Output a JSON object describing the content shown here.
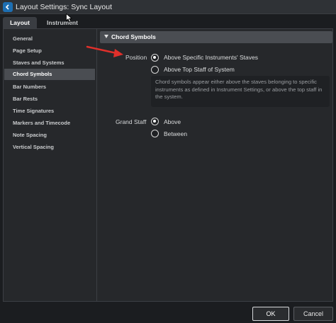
{
  "window": {
    "title": "Layout Settings: Sync Layout"
  },
  "tabs": [
    {
      "label": "Layout",
      "active": true
    },
    {
      "label": "Instrument",
      "active": false
    }
  ],
  "sidebar": {
    "items": [
      {
        "label": "General"
      },
      {
        "label": "Page Setup"
      },
      {
        "label": "Staves and Systems"
      },
      {
        "label": "Chord Symbols",
        "selected": true
      },
      {
        "label": "Bar Numbers"
      },
      {
        "label": "Bar Rests"
      },
      {
        "label": "Time Signatures"
      },
      {
        "label": "Markers and Timecode"
      },
      {
        "label": "Note Spacing"
      },
      {
        "label": "Vertical Spacing"
      }
    ]
  },
  "section": {
    "title": "Chord Symbols",
    "position": {
      "label": "Position",
      "options": [
        {
          "label": "Above Specific Instruments' Staves",
          "checked": true
        },
        {
          "label": "Above Top Staff of System",
          "checked": false
        }
      ],
      "description": "Chord symbols appear either above the staves belonging to specific instruments as defined in Instrument Settings, or above the top staff in the system."
    },
    "grand_staff": {
      "label": "Grand Staff",
      "options": [
        {
          "label": "Above",
          "checked": true
        },
        {
          "label": "Between",
          "checked": false
        }
      ]
    }
  },
  "footer": {
    "ok_label": "OK",
    "cancel_label": "Cancel"
  },
  "colors": {
    "arrow": "#e0302b",
    "accent": "#1d6fb3"
  }
}
